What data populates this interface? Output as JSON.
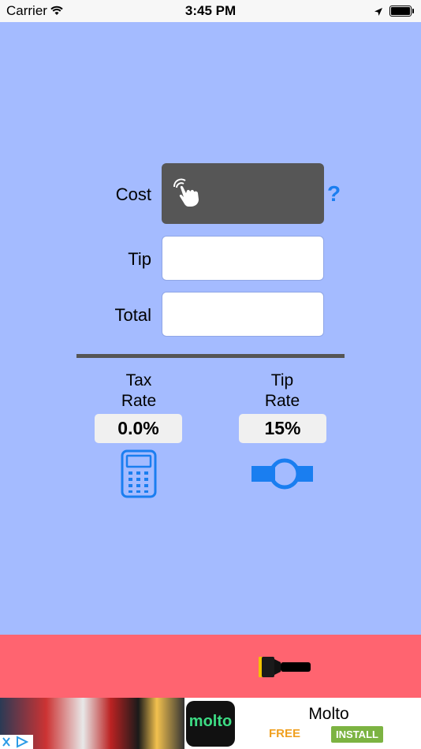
{
  "status_bar": {
    "carrier": "Carrier",
    "time": "3:45 PM"
  },
  "form": {
    "cost_label": "Cost",
    "tip_label": "Tip",
    "total_label": "Total",
    "cost_value": "",
    "tip_value": "",
    "total_value": "",
    "help_symbol": "?"
  },
  "rates": {
    "tax_title_line1": "Tax",
    "tax_title_line2": "Rate",
    "tax_value": "0.0%",
    "tip_title_line1": "Tip",
    "tip_title_line2": "Rate",
    "tip_value": "15%"
  },
  "icons": {
    "cost": "tap-hand-icon",
    "help": "question-icon",
    "tax": "calculator-icon",
    "tip": "slider-icon",
    "bottom": "flashlight-icon"
  },
  "ad": {
    "icon_text": "molto",
    "app_name": "Molto",
    "price": "FREE",
    "install_label": "INSTALL"
  },
  "colors": {
    "background": "#a4bbff",
    "bottom_bar": "#ff6470",
    "accent": "#1a7ef0",
    "cost_field": "#565656"
  }
}
